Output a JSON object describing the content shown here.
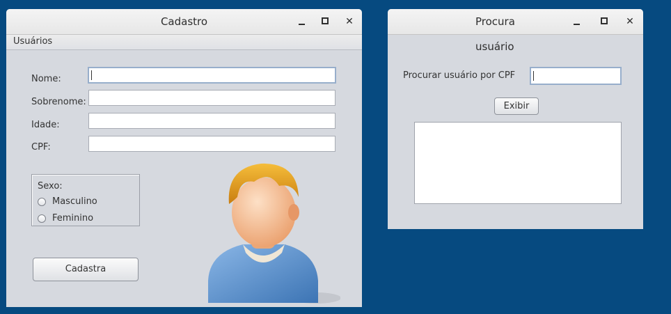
{
  "cadastro_window": {
    "title": "Cadastro",
    "menu": [
      "Usuários"
    ],
    "fields": [
      {
        "label": "Nome:",
        "value": ""
      },
      {
        "label": "Sobrenome:",
        "value": ""
      },
      {
        "label": "Idade:",
        "value": ""
      },
      {
        "label": "CPF:",
        "value": ""
      }
    ],
    "sexo": {
      "title": "Sexo:",
      "options": [
        "Masculino",
        "Feminino"
      ]
    },
    "submit_label": "Cadastra"
  },
  "procura_window": {
    "title": "Procura usuário",
    "search_label": "Procurar usuário por CPF",
    "search_value": "",
    "button_label": "Exibir",
    "result_text": ""
  },
  "colors": {
    "desktop": "#064a80",
    "window_bg": "#d6d9df",
    "avatar_hair": "#e8a21a",
    "avatar_skin": "#f6c39a",
    "avatar_shirt": "#5d93cf"
  },
  "icons": {
    "minimize": "minimize-icon",
    "maximize": "maximize-icon",
    "close": "close-icon",
    "avatar": "user-avatar-icon"
  }
}
